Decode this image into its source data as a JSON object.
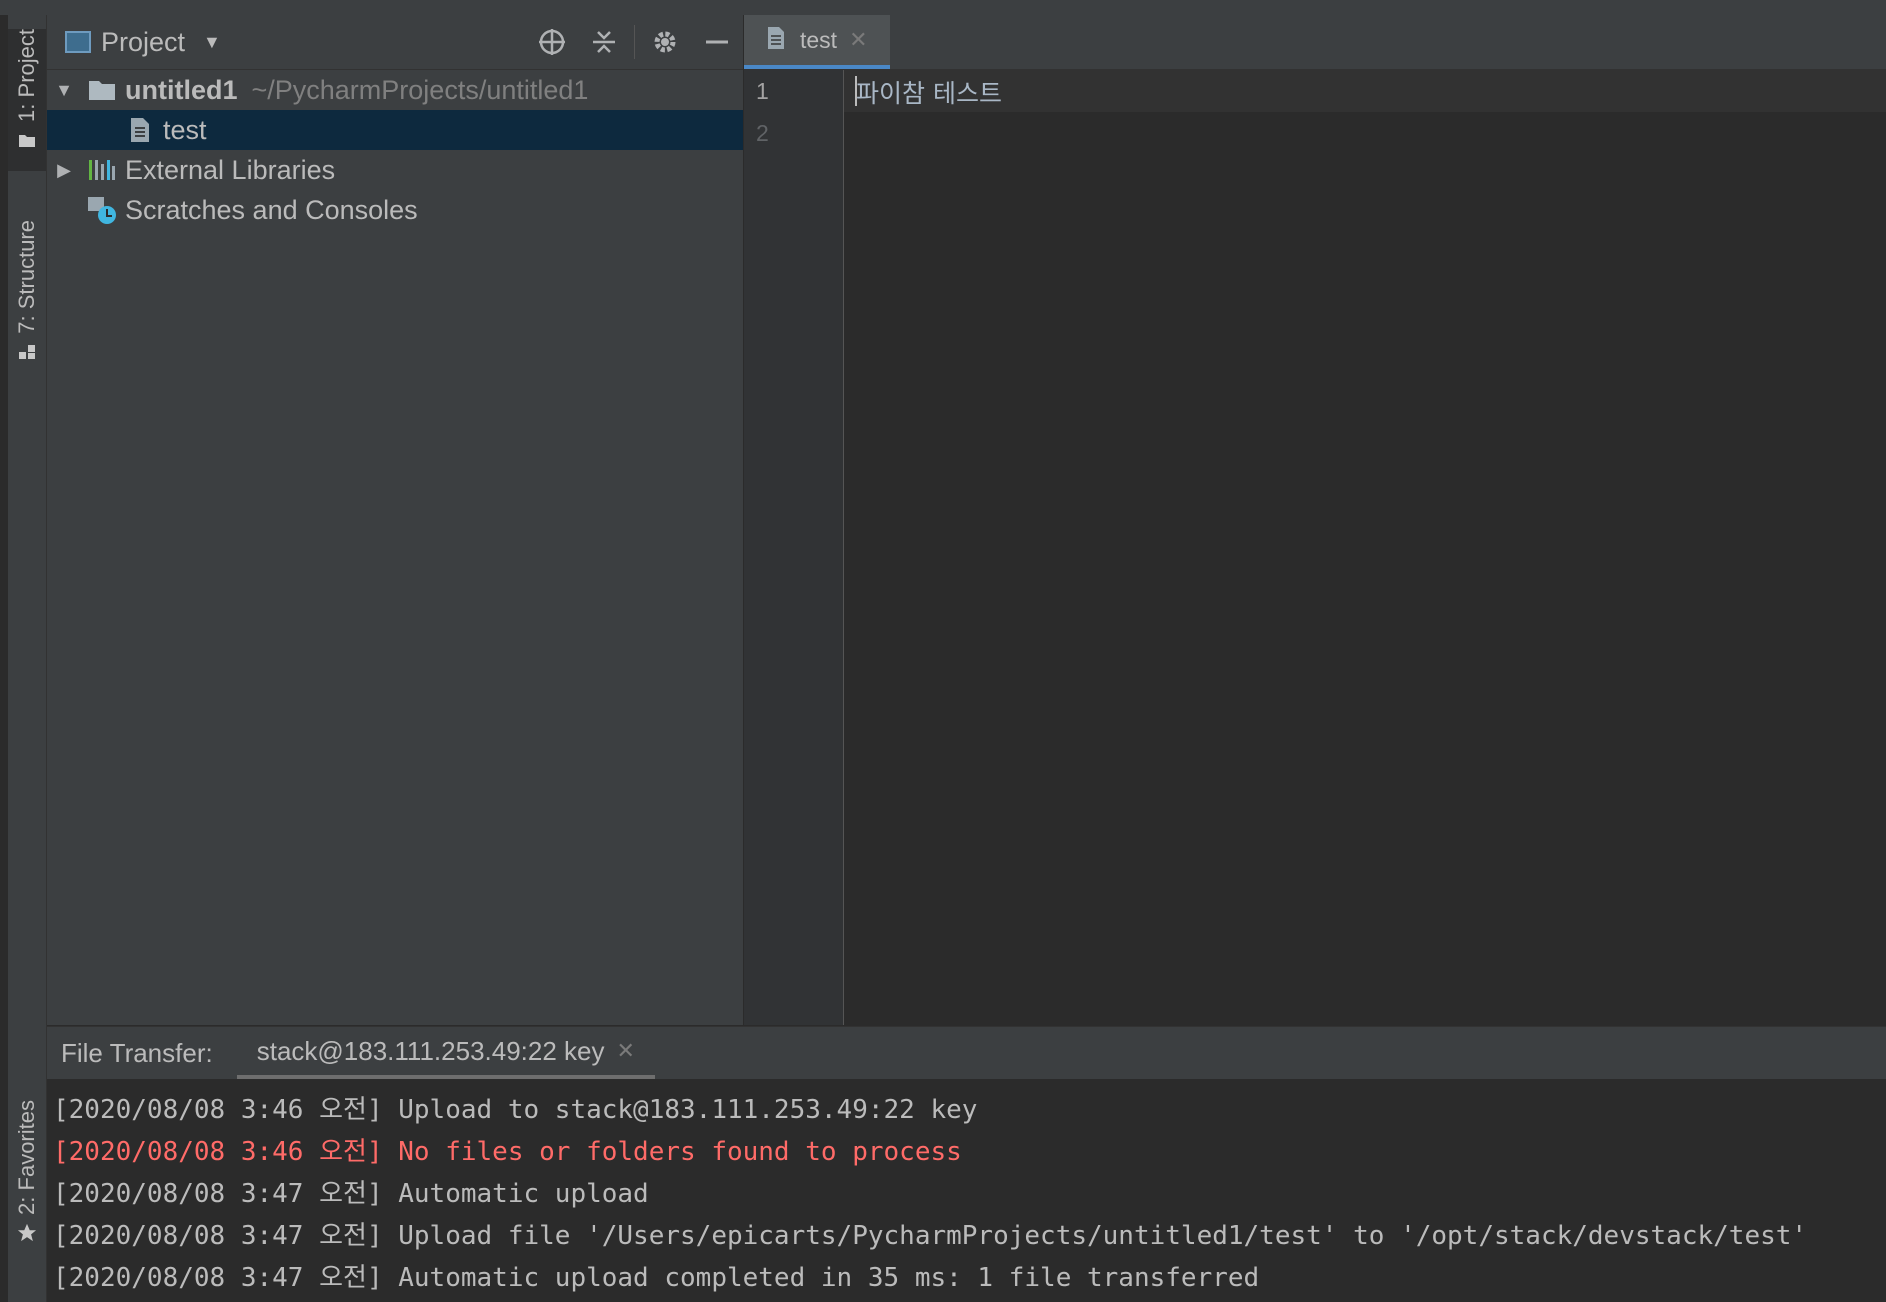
{
  "left_strip": {
    "project_tab": "1: Project",
    "structure_tab": "7: Structure",
    "favorites_tab": "2: Favorites"
  },
  "project_panel": {
    "title": "Project",
    "tree": [
      {
        "name": "untitled1",
        "path": "~/PycharmProjects/untitled1",
        "type": "folder",
        "expanded": true
      },
      {
        "name": "test",
        "type": "file",
        "selected": true
      },
      {
        "name": "External Libraries",
        "type": "libraries",
        "expanded": false
      },
      {
        "name": "Scratches and Consoles",
        "type": "scratches"
      }
    ]
  },
  "editor": {
    "tab_label": "test",
    "line_numbers": [
      "1",
      "2"
    ],
    "lines": [
      "파이참 테스트",
      ""
    ]
  },
  "bottom_panel": {
    "title": "File Transfer:",
    "tab_label": "stack@183.111.253.49:22 key",
    "log": [
      {
        "text": "[2020/08/08 3:46 오전] Upload to stack@183.111.253.49:22 key",
        "level": "info"
      },
      {
        "text": "[2020/08/08 3:46 오전] No files or folders found to process",
        "level": "error"
      },
      {
        "text": "[2020/08/08 3:47 오전] Automatic upload",
        "level": "info"
      },
      {
        "text": "[2020/08/08 3:47 오전] Upload file '/Users/epicarts/PycharmProjects/untitled1/test' to '/opt/stack/devstack/test'",
        "level": "info"
      },
      {
        "text": "[2020/08/08 3:47 오전] Automatic upload completed in 35 ms: 1 file transferred",
        "level": "info"
      }
    ]
  },
  "colors": {
    "background": "#2b2b2b",
    "panel": "#3c3f41",
    "selection": "#0d293e",
    "error_text": "#ff6b68",
    "active_tab_underline": "#4a88c7"
  },
  "icons": [
    "folder-icon",
    "file-icon",
    "libraries-icon",
    "scratches-icon",
    "locate-icon",
    "collapse-all-icon",
    "gear-icon",
    "minimize-icon",
    "close-icon",
    "star-icon",
    "structure-icon"
  ]
}
